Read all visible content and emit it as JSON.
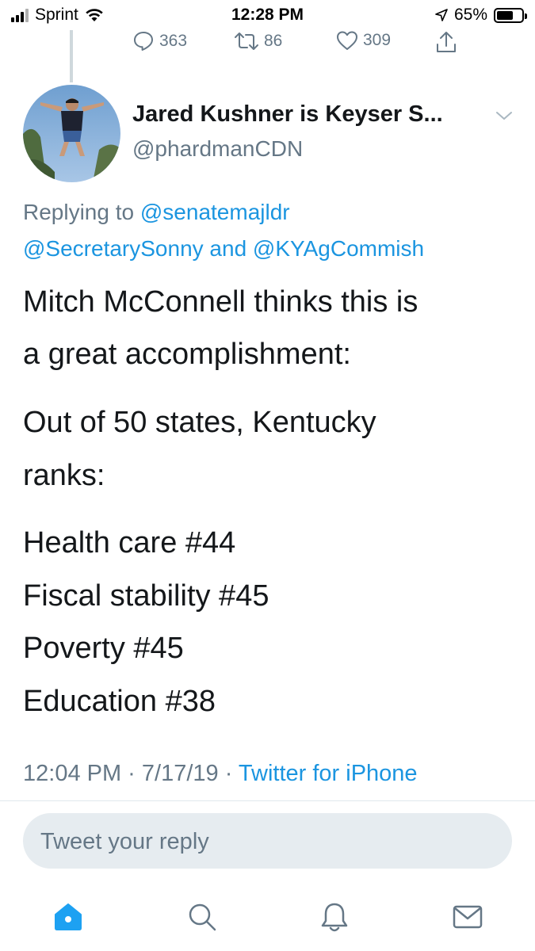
{
  "status_bar": {
    "carrier": "Sprint",
    "time": "12:28 PM",
    "battery_percent": "65%",
    "battery_level": 0.65
  },
  "previous_tweet_actions": {
    "replies": "363",
    "retweets": "86",
    "likes": "309"
  },
  "tweet": {
    "author_name": "Jared Kushner is Keyser S...",
    "author_handle": "@phardmanCDN",
    "replying_prefix": "Replying to ",
    "replying_to_1": "@senatemajldr",
    "replying_to_2": "@SecretarySonny",
    "replying_and": " and ",
    "replying_to_3": "@KYAgCommish",
    "lines": [
      "Mitch McConnell thinks this is",
      "a great accomplishment:",
      "Out of 50 states, Kentucky",
      "ranks:",
      "Health care #44",
      "Fiscal stability #45",
      "Poverty #45",
      "Education #38"
    ],
    "timestamp": "12:04 PM · 7/17/19 · ",
    "source": "Twitter for iPhone"
  },
  "reply_composer": {
    "placeholder": "Tweet your reply"
  },
  "colors": {
    "link": "#1b95e0",
    "secondary_text": "#657786",
    "active_tab": "#1da1f2"
  },
  "tab_bar": {
    "tabs": [
      "home-icon",
      "search-icon",
      "notifications-icon",
      "messages-icon"
    ],
    "active": "home-icon"
  }
}
